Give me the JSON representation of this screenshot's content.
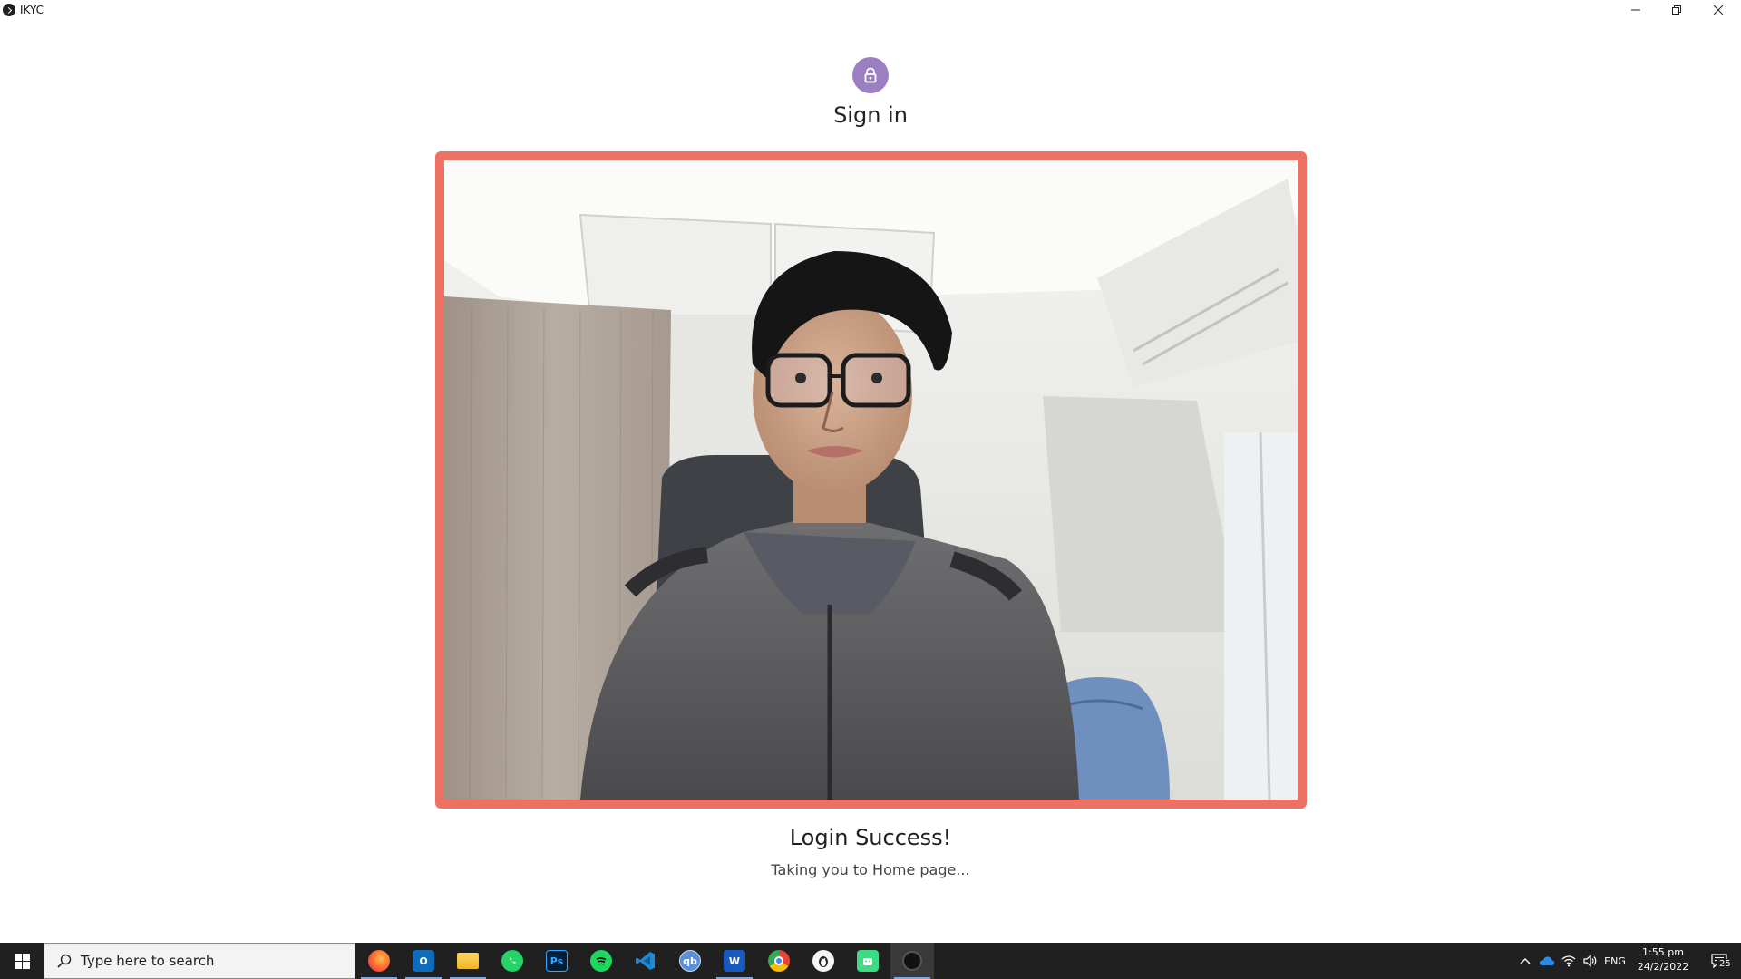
{
  "window": {
    "title": "IKYC"
  },
  "signin": {
    "title": "Sign in"
  },
  "status": {
    "title": "Login Success!",
    "subtitle": "Taking you to Home page..."
  },
  "colors": {
    "accent_frame": "#ee7263",
    "avatar": "#9c7fc0",
    "taskbar": "#202020"
  },
  "taskbar": {
    "search_placeholder": "Type here to search",
    "apps": [
      {
        "name": "firefox-icon"
      },
      {
        "name": "outlook-icon"
      },
      {
        "name": "file-explorer-icon"
      },
      {
        "name": "whatsapp-icon"
      },
      {
        "name": "photoshop-icon",
        "label": "Ps"
      },
      {
        "name": "spotify-icon"
      },
      {
        "name": "vscode-icon"
      },
      {
        "name": "qbittorrent-icon",
        "label": "qb"
      },
      {
        "name": "word-icon",
        "label": "W"
      },
      {
        "name": "chrome-icon"
      },
      {
        "name": "penguin-app-icon"
      },
      {
        "name": "android-studio-icon"
      },
      {
        "name": "ikyc-app-icon"
      }
    ],
    "tray": {
      "language": "ENG",
      "time": "1:55 pm",
      "date": "24/2/2022",
      "notification_count": "25"
    }
  }
}
